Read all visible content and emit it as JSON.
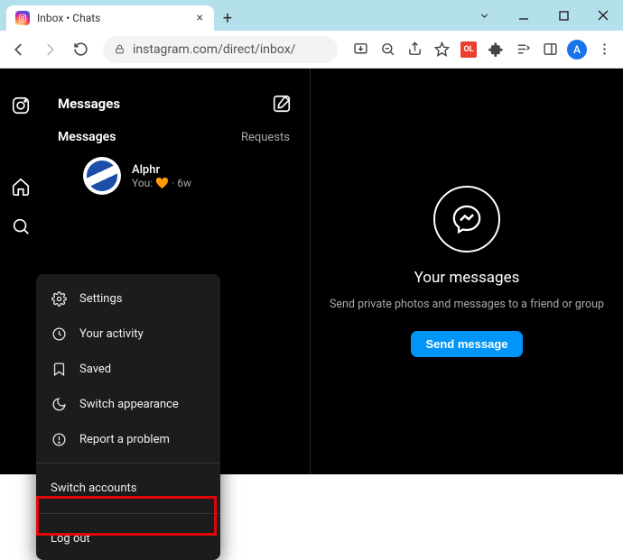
{
  "window": {
    "tab_title": "Inbox • Chats",
    "url": "instagram.com/direct/inbox/",
    "avatar_letter": "A",
    "extension_badge": "OL"
  },
  "dm": {
    "header": "Messages",
    "requests": "Requests",
    "conversation": {
      "name": "Alphr",
      "subline": "You: 🧡 · 6w"
    }
  },
  "menu": {
    "settings": "Settings",
    "activity": "Your activity",
    "saved": "Saved",
    "appearance": "Switch appearance",
    "report": "Report a problem",
    "switch": "Switch accounts",
    "logout": "Log out"
  },
  "empty_state": {
    "title": "Your messages",
    "subtitle": "Send private photos and messages to a friend or group",
    "button": "Send message"
  }
}
